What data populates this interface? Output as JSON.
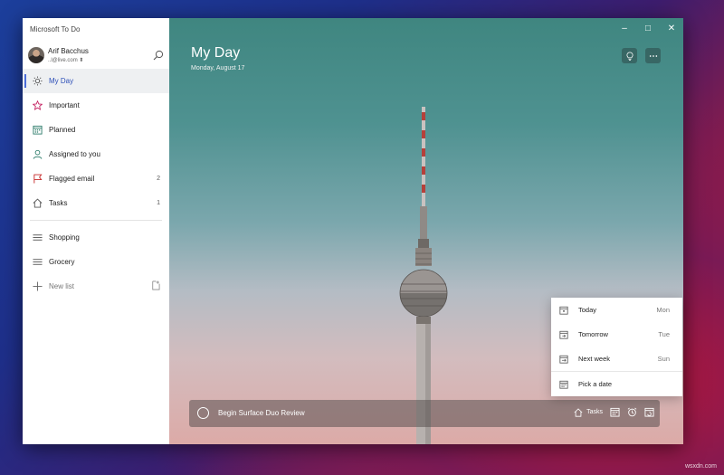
{
  "app": {
    "title": "Microsoft To Do"
  },
  "profile": {
    "name": "Arif Bacchus",
    "email": "..l@live.com ⬍"
  },
  "nav": {
    "items": [
      {
        "label": "My Day",
        "icon": "sun-icon",
        "count": ""
      },
      {
        "label": "Important",
        "icon": "star-icon",
        "count": ""
      },
      {
        "label": "Planned",
        "icon": "calendar-icon",
        "count": ""
      },
      {
        "label": "Assigned to you",
        "icon": "person-icon",
        "count": ""
      },
      {
        "label": "Flagged email",
        "icon": "flag-icon",
        "count": "2"
      },
      {
        "label": "Tasks",
        "icon": "home-icon",
        "count": "1"
      }
    ],
    "lists": [
      {
        "label": "Shopping",
        "icon": "list-icon"
      },
      {
        "label": "Grocery",
        "icon": "list-icon"
      }
    ],
    "new_list": "New list"
  },
  "window_controls": {
    "minimize": "–",
    "maximize": "□",
    "close": "✕"
  },
  "main": {
    "title": "My Day",
    "date": "Monday, August 17",
    "add_task": {
      "text": "Begin Surface Duo Review",
      "list_label": "Tasks"
    }
  },
  "date_menu": {
    "items": [
      {
        "label": "Today",
        "day": "Mon"
      },
      {
        "label": "Tomorrow",
        "day": "Tue"
      },
      {
        "label": "Next week",
        "day": "Sun"
      },
      {
        "label": "Pick a date",
        "day": ""
      }
    ]
  },
  "colors": {
    "accent": "#4a6cd8",
    "important": "#c2185b",
    "planned": "#2e7d6b",
    "assigned": "#2e7d6b",
    "flagged": "#c62828"
  },
  "watermark": "wsxdn.com"
}
